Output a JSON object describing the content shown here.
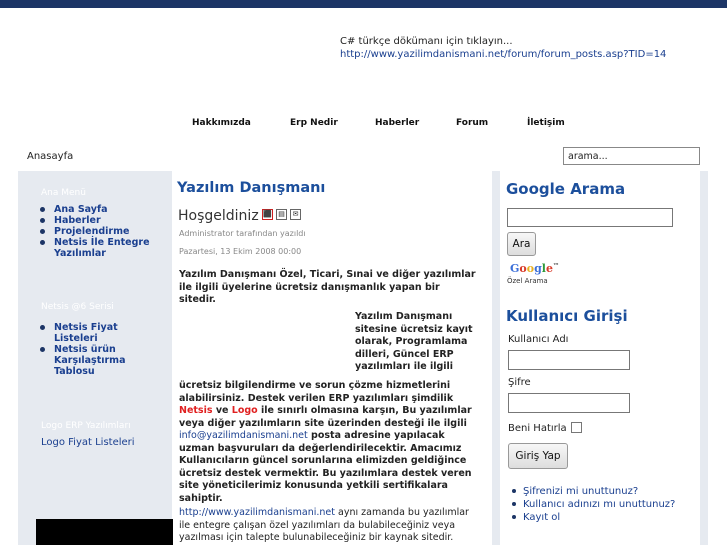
{
  "notice": {
    "line1": "C# türkçe dökümanı için tıklayın...",
    "line2": "http://www.yazilimdanismani.net/forum/forum_posts.asp?TID=14"
  },
  "nav": [
    "Hakkımızda",
    "Erp Nedir",
    "Haberler",
    "Forum",
    "İletişim"
  ],
  "breadcrumb": "Anasayfa",
  "search": {
    "value": "arama..."
  },
  "left": {
    "menu_title": "Ana Menü",
    "menu": [
      "Ana Sayfa",
      "Haberler",
      "Projelendirme",
      "Netsis İle Entegre Yazılımlar"
    ],
    "netsis_title": "Netsis @6 Serisi",
    "netsis": [
      "Netsis Fiyat Listeleri",
      "Netsis ürün Karşılaştırma Tablosu"
    ],
    "logo_title": "Logo ERP Yazılımları",
    "logo_link": "Logo Fiyat Listeleri"
  },
  "article": {
    "site_title": "Yazılım Danışmanı",
    "title": "Hoşgeldiniz",
    "author": "Administrator tarafından yazıldı",
    "date": "Pazartesi, 13 Ekim 2008 00:00",
    "p1": "Yazılım Danışmanı Özel, Ticari, Sınai ve diğer yazılımlar ile ilgili üyelerine ücretsiz danışmanlık yapan bir sitedir.",
    "p2a": "Yazılım Danışmanı sitesine ücretsiz kayıt olarak,  Programlama dilleri,  Güncel ERP yazılımları ile ilgili",
    "p2b": "ücretsiz bilgilendirme ve sorun çözme hizmetlerini alabilirsiniz. Destek verilen ERP yazılımları şimdilik",
    "netsis": "Netsis",
    "ve": "ve",
    "logo": "Logo",
    "p2c": "ile sınırlı olmasına karşın, Bu yazılımlar veya diğer yazılımların site üzerinden desteği ile ilgili",
    "email": "info@yazilimdanismani.net",
    "p2d": "posta adresine yapılacak uzman başvuruları da değerlendirilecektir. Amacımız Kullanıcıların güncel sorunlarına elimizden geldiğince ücretsiz destek vermektir. Bu yazılımlara destek veren site yöneticilerimiz konusunda yetkili sertifikalara sahiptir.",
    "url": "http://www.yazilimdanismani.net",
    "p3": "aynı zamanda bu yazılımlar ile entegre çalışan özel yazılımları da bulabileceğiniz veya yazılması için talepte bulunabileceğiniz bir kaynak sitedir."
  },
  "google": {
    "title": "Google Arama",
    "button": "Ara",
    "logo": "Google",
    "tm": "™",
    "sub": "Özel Arama"
  },
  "login": {
    "title": "Kullanıcı Girişi",
    "username_label": "Kullanıcı Adı",
    "password_label": "Şifre",
    "remember_label": "Beni Hatırla",
    "button": "Giriş Yap",
    "links": [
      "Şifrenizi mi unuttunuz?",
      "Kullanıcı adınızı mı unuttunuz?",
      "Kayıt ol"
    ]
  },
  "colors": {
    "accent": "#1c4f9c",
    "topbar": "#1c3566",
    "panel": "#e6eaf0",
    "highlight": "#e02020"
  }
}
